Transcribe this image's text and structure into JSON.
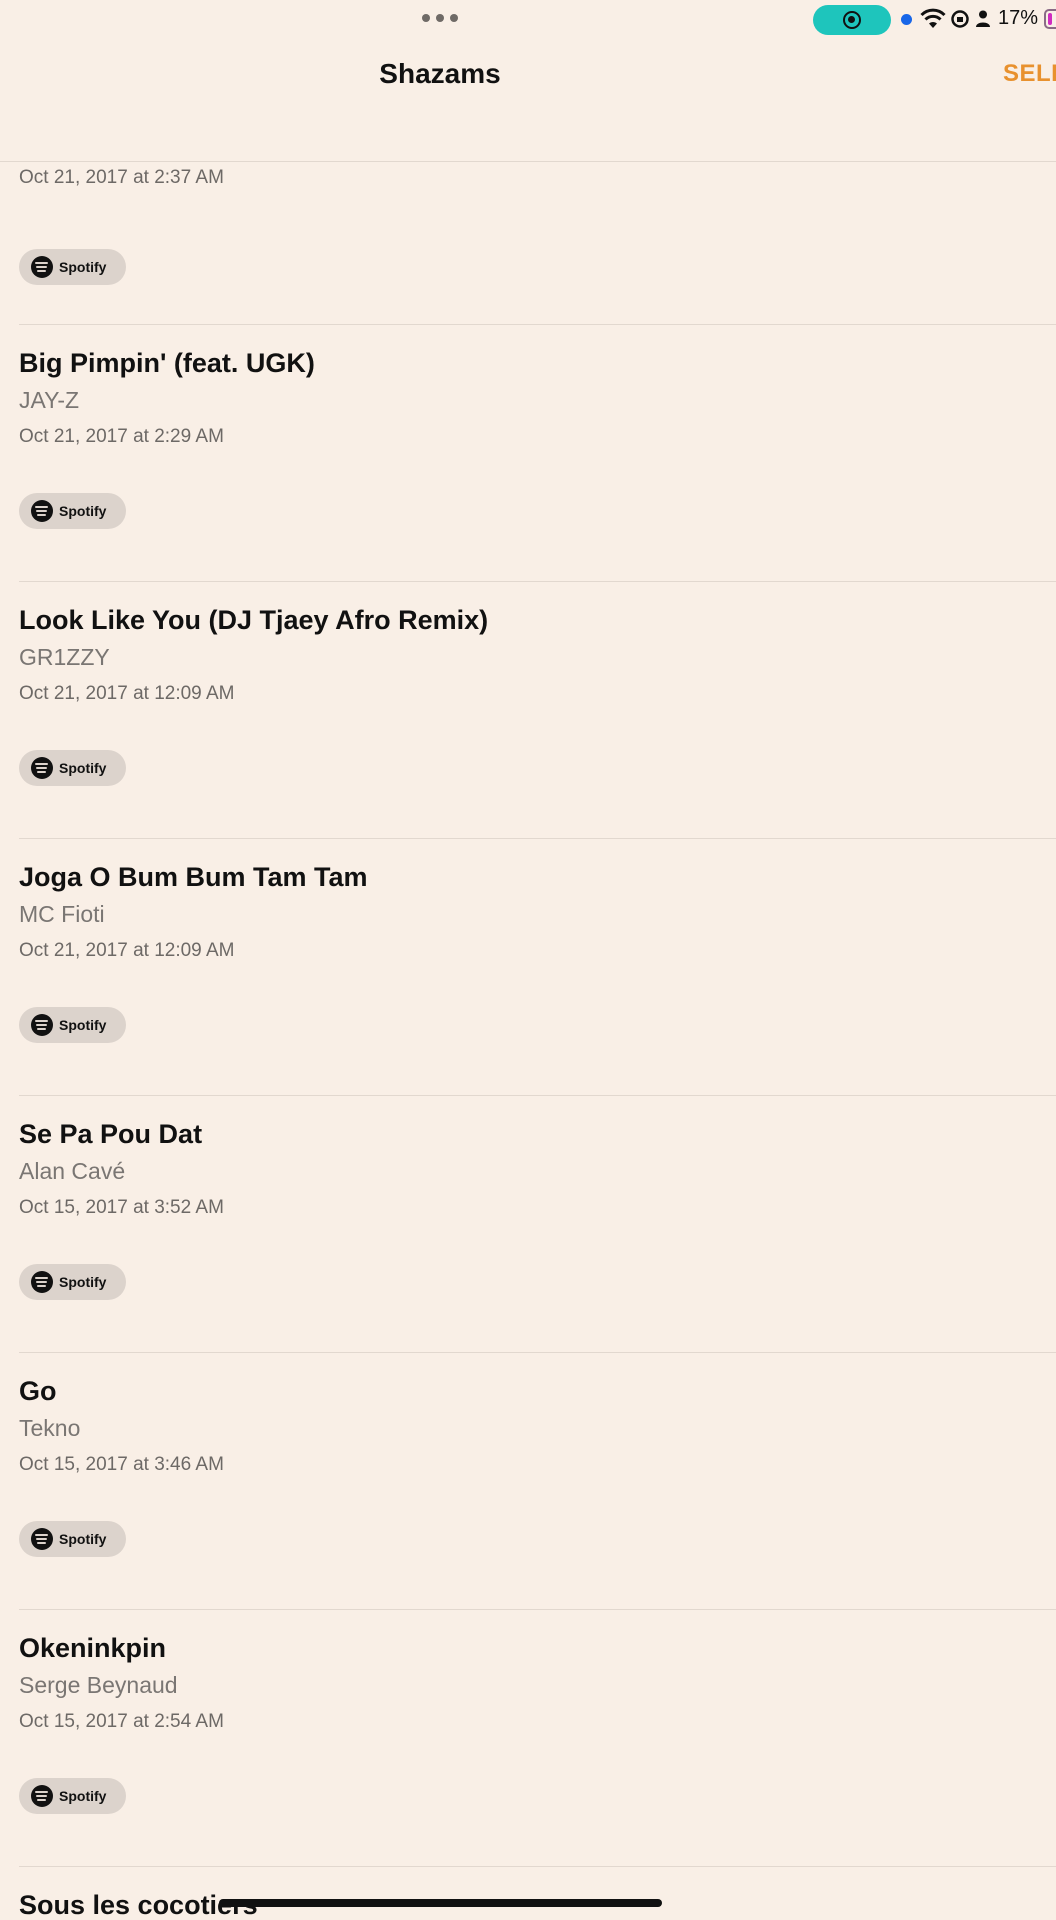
{
  "status": {
    "battery_percent": "17%",
    "icons": [
      "more-dots-icon",
      "screen-record-icon",
      "location-dot-icon",
      "wifi-icon",
      "rotation-lock-icon",
      "person-icon",
      "battery-icon"
    ]
  },
  "nav": {
    "title": "Shazams",
    "select_label": "SELE"
  },
  "items": [
    {
      "title": "",
      "artist": "",
      "date": "Oct 21, 2017 at 2:37 AM",
      "button": "Spotify"
    },
    {
      "title": "Big Pimpin' (feat. UGK)",
      "artist": "JAY-Z",
      "date": "Oct 21, 2017 at 2:29 AM",
      "button": "Spotify"
    },
    {
      "title": "Look Like You (DJ Tjaey Afro Remix)",
      "artist": "GR1ZZY",
      "date": "Oct 21, 2017 at 12:09 AM",
      "button": "Spotify"
    },
    {
      "title": "Joga O Bum Bum Tam Tam",
      "artist": "MC Fioti",
      "date": "Oct 21, 2017 at 12:09 AM",
      "button": "Spotify"
    },
    {
      "title": "Se Pa Pou Dat",
      "artist": "Alan Cavé",
      "date": "Oct 15, 2017 at 3:52 AM",
      "button": "Spotify"
    },
    {
      "title": "Go",
      "artist": "Tekno",
      "date": "Oct 15, 2017 at 3:46 AM",
      "button": "Spotify"
    },
    {
      "title": "Okeninkpin",
      "artist": "Serge Beynaud",
      "date": "Oct 15, 2017 at 2:54 AM",
      "button": "Spotify"
    },
    {
      "title": "Sous les cocotiers",
      "artist": "",
      "date": "",
      "button": ""
    }
  ],
  "colors": {
    "background": "#f9efe6",
    "accent": "#e8912e",
    "record_pill": "#1ec5bc"
  }
}
